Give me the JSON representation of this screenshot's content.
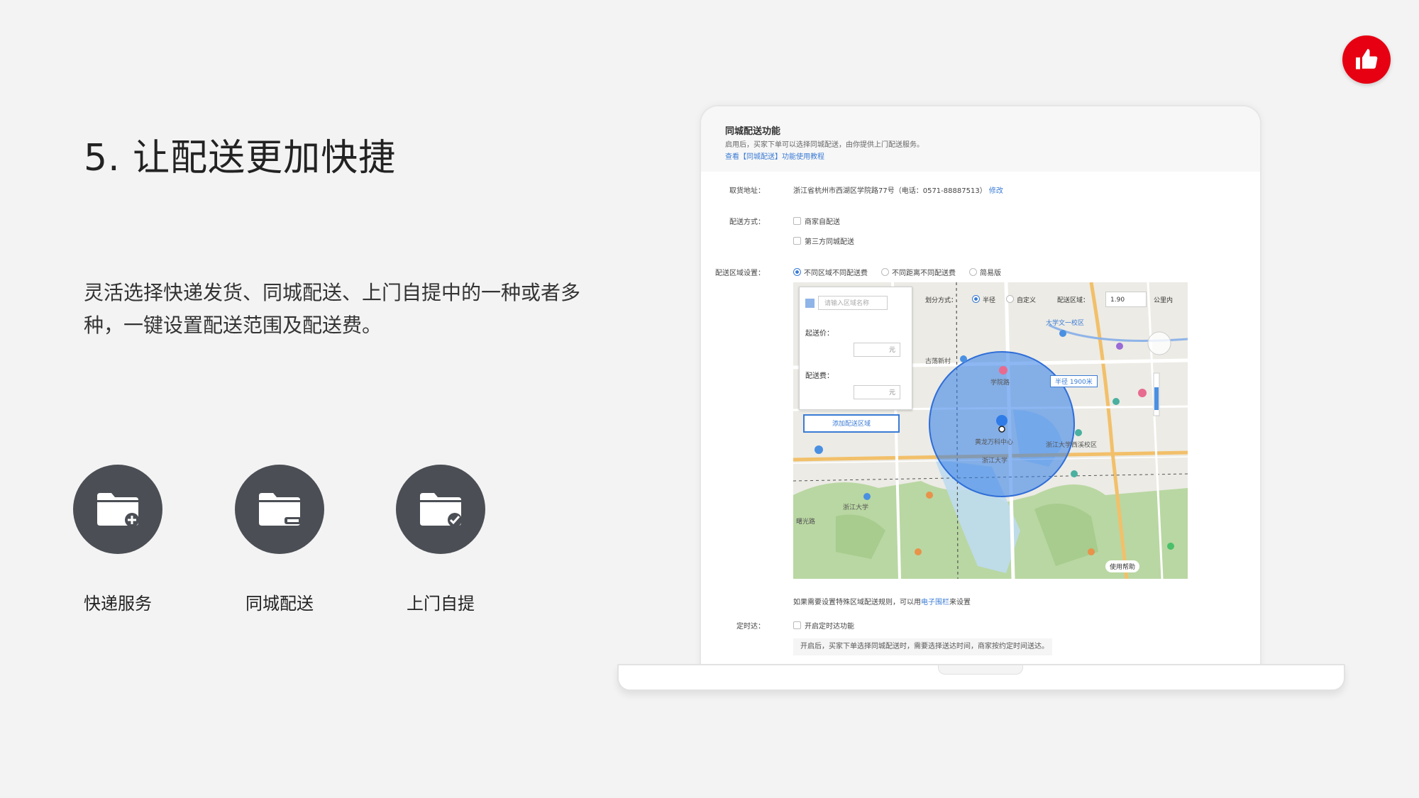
{
  "page": {
    "title": "5. 让配送更加快捷",
    "description": "灵活选择快递发货、同城配送、上门自提中的一种或者多种，一键设置配送范围及配送费。",
    "accent_color": "#e60012",
    "badge_icon": "thumbs-up-icon"
  },
  "features": [
    {
      "label": "快递服务",
      "icon": "folder-plus-icon"
    },
    {
      "label": "同城配送",
      "icon": "folder-minus-icon"
    },
    {
      "label": "上门自提",
      "icon": "folder-check-icon"
    }
  ],
  "screen": {
    "header": {
      "title": "同城配送功能",
      "subtitle": "启用后，买家下单可以选择同城配送，由你提供上门配送服务。",
      "link": "查看【同城配送】功能使用教程"
    },
    "address": {
      "label": "取货地址：",
      "value": "浙江省杭州市西湖区学院路77号（电话：0571-88887513）",
      "edit": "修改"
    },
    "delivery_method": {
      "label": "配送方式：",
      "options": [
        "商家自配送",
        "第三方同城配送"
      ]
    },
    "zone_settings": {
      "label": "配送区域设置：",
      "options": [
        "不同区域不同配送费",
        "不同距离不同配送费",
        "简易版"
      ]
    },
    "map_panel": {
      "search_placeholder": "请输入区域名称",
      "min_price_label": "起送价：",
      "min_price_unit": "元",
      "fee_label": "配送费：",
      "fee_unit": "元",
      "add_zone": "添加配送区域"
    },
    "map_toolbar": {
      "mode_label": "划分方式：",
      "radius": "半径",
      "custom": "自定义",
      "zone_label": "配送区域：",
      "km_value": "1.90",
      "km_unit": "公里内"
    },
    "map_labels": {
      "radius_tag": "半径 1900米",
      "place_1": "大学文一校区",
      "place_2": "古荡新村",
      "place_3": "学院路",
      "place_4": "黄龙万科中心",
      "place_5": "浙江大学西溪校区",
      "place_6": "浙江大学",
      "place_7": "曙光路",
      "place_8": "浙江大学",
      "help": "使用帮助"
    },
    "note": {
      "prefix": "如果需要设置特殊区域配送规则，可以用",
      "link": "电子围栏",
      "suffix": "来设置"
    },
    "timed": {
      "label": "定时达：",
      "checkbox": "开启定时达功能",
      "hint": "开启后，买家下单选择同城配送时，需要选择送达时间，商家按约定时间送达。"
    }
  }
}
